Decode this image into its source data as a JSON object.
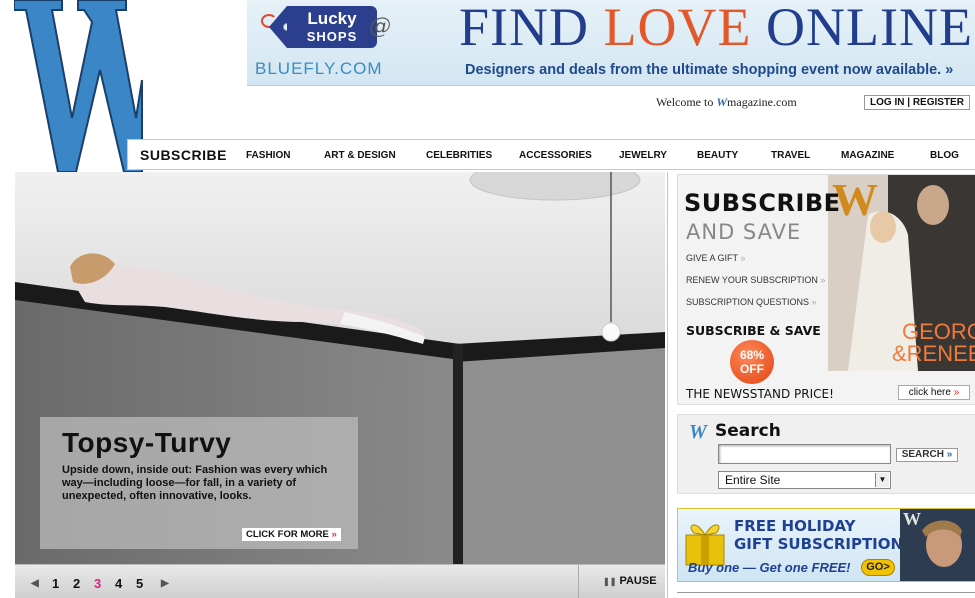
{
  "logo": {
    "letter": "W"
  },
  "banner": {
    "tag_lucky": "Lucky",
    "tag_shops": "SHOPS",
    "at": "@",
    "bluefly": "BLUEFLY.COM",
    "headline_find": "FIND ",
    "headline_love": "LOVE",
    "headline_online": " ONLINE",
    "subline": "Designers and deals from the ultimate shopping event now available. »"
  },
  "header": {
    "welcome_prefix": "Welcome to ",
    "welcome_w": "W",
    "welcome_suffix": "magazine.com",
    "login": "LOG IN | REGISTER"
  },
  "nav": {
    "subscribe": "SUBSCRIBE",
    "items": [
      "FASHION",
      "ART & DESIGN",
      "CELEBRITIES",
      "ACCESSORIES",
      "JEWELRY",
      "BEAUTY",
      "TRAVEL",
      "MAGAZINE",
      "BLOG"
    ]
  },
  "hero": {
    "title": "Topsy-Turvy",
    "text": "Upside down, inside out: Fashion was every which way—including loose—for fall, in a variety of unexpected, often innovative, looks.",
    "more": "CLICK FOR MORE",
    "more_arrow": "»"
  },
  "carousel": {
    "prev": "◀",
    "next": "▶",
    "pages": [
      "1",
      "2",
      "3",
      "4",
      "5"
    ],
    "active_page": "3",
    "pause": "PAUSE",
    "pause_icon": "❚❚"
  },
  "promo": {
    "title": "SUBSCRIBE",
    "title2": "AND SAVE",
    "links": [
      "GIVE A GIFT",
      "RENEW YOUR SUBSCRIPTION",
      "SUBSCRIPTION QUESTIONS"
    ],
    "link_arrow": "»",
    "subscribe_save": "SUBSCRIBE & SAVE",
    "badge_pct": "68%",
    "badge_off": "OFF",
    "newsstand": "THE NEWSSTAND PRICE!",
    "click_here": "click here",
    "cover_names": "GEORGE & RENEE",
    "cover_logo": "W"
  },
  "search": {
    "w": "W",
    "title": "Search",
    "input_value": "",
    "button": "SEARCH",
    "button_arrow": "»",
    "scope": "Entire Site",
    "scope_caret": "▼"
  },
  "holiday": {
    "line1": "FREE HOLIDAY",
    "line2": "GIFT SUBSCRIPTION!",
    "buy": "Buy one — Get one FREE!",
    "go": "GO>"
  },
  "colors": {
    "logo_blue": "#3b86c6",
    "nav_border": "#c9c9c9",
    "accent_pink": "#e0207a",
    "banner_navy": "#213d8c",
    "banner_orange": "#e2582a"
  }
}
